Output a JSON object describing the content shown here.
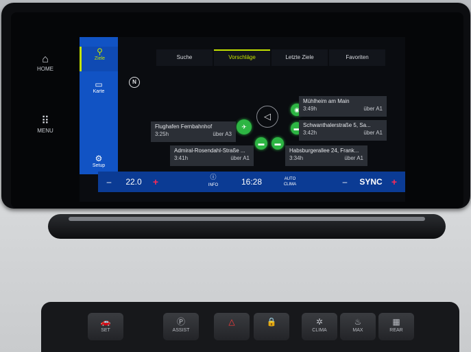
{
  "hard_keys": {
    "home": {
      "label": "HOME",
      "icon": "home-icon"
    },
    "menu": {
      "label": "MENU",
      "icon": "grid-icon"
    }
  },
  "sidebar": {
    "items": [
      {
        "label": "Ziele",
        "icon": "destination-icon",
        "active": true
      },
      {
        "label": "Karte",
        "icon": "map-icon"
      },
      {
        "label": "Setup",
        "icon": "settings-icon"
      }
    ]
  },
  "tabs": [
    {
      "label": "Suche"
    },
    {
      "label": "Vorschläge",
      "active": true
    },
    {
      "label": "Letzte Ziele"
    },
    {
      "label": "Favoriten"
    }
  ],
  "map": {
    "compass": "N"
  },
  "destinations": [
    {
      "name": "Mühlheim am Main",
      "time": "3:49h",
      "route": "über A1"
    },
    {
      "name": "Schwanthalerstraße 5, Sa...",
      "time": "3:42h",
      "route": "über A1"
    },
    {
      "name": "Flughafen Fernbahnhof",
      "time": "3:25h",
      "route": "über A3"
    },
    {
      "name": "Admiral-Rosendahl-Straße ...",
      "time": "3:41h",
      "route": "über A1"
    },
    {
      "name": "Habsburgerallee 24, Frank...",
      "time": "3:34h",
      "route": "über A1"
    }
  ],
  "status_bar": {
    "minus_left": "–",
    "temp_left": "22.0",
    "plus_left": "+",
    "info": "INFO",
    "time": "16:28",
    "auto": "AUTO",
    "clima": "CLIMA",
    "minus_right": "–",
    "sync": "SYNC",
    "plus_right": "+"
  },
  "hardware_buttons": [
    {
      "label": "SET",
      "icon": "car-icon"
    },
    {
      "label": "ASSIST",
      "icon": "parking-assist-icon"
    },
    {
      "label": "",
      "icon": "hazard-icon"
    },
    {
      "label": "",
      "icon": "lock-icon"
    },
    {
      "label": "CLIMA",
      "icon": "climate-icon"
    },
    {
      "label": "MAX",
      "icon": "defrost-max-icon"
    },
    {
      "label": "REAR",
      "icon": "rear-defrost-icon"
    }
  ],
  "colors": {
    "accent": "#c5e300",
    "nav_blue": "#1153c4",
    "pin_green": "#2db543",
    "plus_red": "#ff2a56"
  }
}
